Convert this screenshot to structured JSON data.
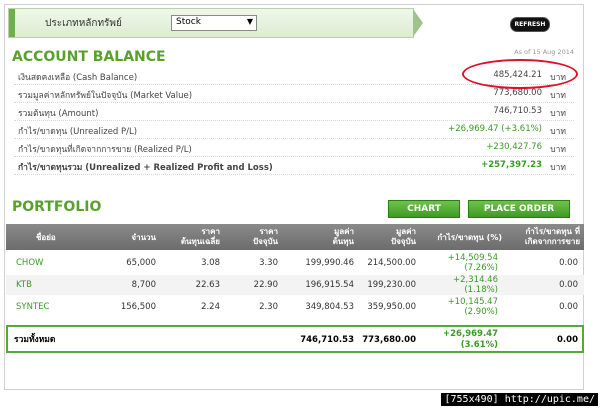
{
  "selector": {
    "label": "ประเภทหลักทรัพย์",
    "selected": "Stock"
  },
  "refresh_label": "REFRESH",
  "account": {
    "title": "ACCOUNT BALANCE",
    "as_of": "As of 15 Aug 2014",
    "rows": [
      {
        "label": "เงินสดคงเหลือ (Cash Balance)",
        "value": "485,424.21",
        "unit": "บาท"
      },
      {
        "label": "รวมมูลค่าหลักทรัพย์ในปัจจุบัน (Market Value)",
        "value": "773,680.00",
        "unit": "บาท"
      },
      {
        "label": "รวมต้นทุน (Amount)",
        "value": "746,710.53",
        "unit": "บาท"
      },
      {
        "label": "กำไร/ขาดทุน (Unrealized P/L)",
        "value": "+26,969.47 (+3.61%)",
        "unit": "บาท"
      },
      {
        "label": "กำไร/ขาดทุนที่เกิดจากการขาย (Realized P/L)",
        "value": "+230,427.76",
        "unit": "บาท"
      },
      {
        "label": "กำไร/ขาดทุนรวม (Unrealized + Realized Profit and Loss)",
        "value": "+257,397.23",
        "unit": "บาท"
      }
    ]
  },
  "portfolio": {
    "title": "PORTFOLIO",
    "chart_button": "CHART",
    "place_order_button": "PLACE ORDER",
    "headers": {
      "name": "ชื่อย่อ",
      "volume": "จำนวน",
      "avg1": "ราคา",
      "avg2": "ต้นทุนเฉลี่ย",
      "cur1": "ราคา",
      "cur2": "ปัจจุบัน",
      "cost1": "มูลค่า",
      "cost2": "ต้นทุน",
      "mkt1": "มูลค่า",
      "mkt2": "ปัจจุบัน",
      "pl": "กำไร/ขาดทุน (%)",
      "real1": "กำไร/ขาดทุน ที่",
      "real2": "เกิดจากการขาย"
    },
    "rows": [
      {
        "name": "CHOW",
        "volume": "65,000",
        "avg": "3.08",
        "cur": "3.30",
        "cost": "199,990.46",
        "mkt": "214,500.00",
        "pl": "+14,509.54",
        "pl_pct": "(7.26%)",
        "realized": "0.00"
      },
      {
        "name": "KTB",
        "volume": "8,700",
        "avg": "22.63",
        "cur": "22.90",
        "cost": "196,915.54",
        "mkt": "199,230.00",
        "pl": "+2,314.46",
        "pl_pct": "(1.18%)",
        "realized": "0.00"
      },
      {
        "name": "SYNTEC",
        "volume": "156,500",
        "avg": "2.24",
        "cur": "2.30",
        "cost": "349,804.53",
        "mkt": "359,950.00",
        "pl": "+10,145.47",
        "pl_pct": "(2.90%)",
        "realized": "0.00"
      }
    ],
    "total": {
      "label": "รวมทั้งหมด",
      "cost": "746,710.53",
      "mkt": "773,680.00",
      "pl": "+26,969.47",
      "pl_pct": "(3.61%)",
      "realized": "0.00"
    }
  },
  "footer": "[755x490] http://upic.me/"
}
